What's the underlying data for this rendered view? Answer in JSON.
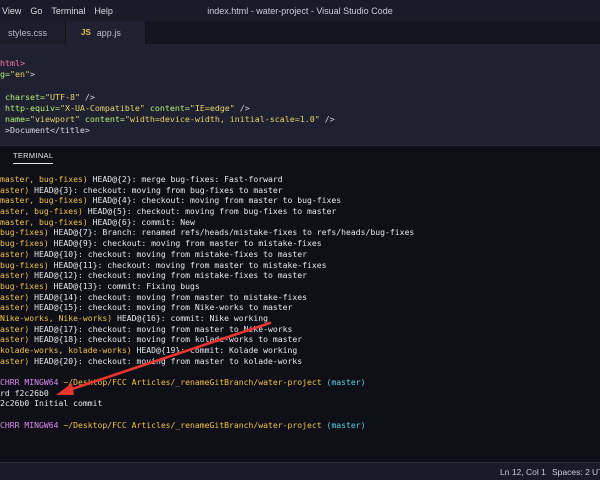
{
  "menu": [
    "View",
    "Go",
    "Terminal",
    "Help"
  ],
  "window_title": "index.html - water-project - Visual Studio Code",
  "tabs": [
    {
      "label": "styles.css",
      "icon": ""
    },
    {
      "label": "app.js",
      "icon": "JS"
    }
  ],
  "editor": {
    "lines": [
      [
        {
          "t": "html>",
          "c": "tag"
        }
      ],
      [
        {
          "t": "g=",
          "c": "attr"
        },
        {
          "t": "\"en\"",
          "c": "str"
        },
        {
          "t": ">",
          "c": "pl"
        }
      ],
      [],
      [
        {
          "t": " charset=",
          "c": "attr"
        },
        {
          "t": "\"UTF-8\"",
          "c": "str"
        },
        {
          "t": " />",
          "c": "pl"
        }
      ],
      [
        {
          "t": " http-equiv=",
          "c": "attr"
        },
        {
          "t": "\"X-UA-Compatible\"",
          "c": "str"
        },
        {
          "t": " content=",
          "c": "attr"
        },
        {
          "t": "\"IE=edge\"",
          "c": "str"
        },
        {
          "t": " />",
          "c": "pl"
        }
      ],
      [
        {
          "t": " name=",
          "c": "attr"
        },
        {
          "t": "\"viewport\"",
          "c": "str"
        },
        {
          "t": " content=",
          "c": "attr"
        },
        {
          "t": "\"width=device-width, initial-scale=1.0\"",
          "c": "str"
        },
        {
          "t": " />",
          "c": "pl"
        }
      ],
      [
        {
          "t": " >Document</title>",
          "c": "pl"
        }
      ]
    ]
  },
  "panel": {
    "tab": "TERMINAL"
  },
  "terminal": {
    "lines": [
      [
        {
          "t": "master, bug-fixes)",
          "c": "yellow"
        },
        {
          "t": " HEAD@{2}: merge bug-fixes: Fast-forward",
          "c": "white"
        }
      ],
      [
        {
          "t": "aster)",
          "c": "yellow"
        },
        {
          "t": " HEAD@{3}: checkout: moving from bug-fixes to master",
          "c": "white"
        }
      ],
      [
        {
          "t": "master, bug-fixes)",
          "c": "yellow"
        },
        {
          "t": " HEAD@{4}: checkout: moving from master to bug-fixes",
          "c": "white"
        }
      ],
      [
        {
          "t": "aster, bug-fixes)",
          "c": "yellow"
        },
        {
          "t": " HEAD@{5}: checkout: moving from bug-fixes to master",
          "c": "white"
        }
      ],
      [
        {
          "t": "master, bug-fixes)",
          "c": "yellow"
        },
        {
          "t": " HEAD@{6}: commit: New",
          "c": "white"
        }
      ],
      [
        {
          "t": "bug-fixes)",
          "c": "yellow"
        },
        {
          "t": " HEAD@{7}: Branch: renamed refs/heads/mistake-fixes to refs/heads/bug-fixes",
          "c": "white"
        }
      ],
      [
        {
          "t": "bug-fixes)",
          "c": "yellow"
        },
        {
          "t": " HEAD@{9}: checkout: moving from master to mistake-fixes",
          "c": "white"
        }
      ],
      [
        {
          "t": "aster)",
          "c": "yellow"
        },
        {
          "t": " HEAD@{10}: checkout: moving from mistake-fixes to master",
          "c": "white"
        }
      ],
      [
        {
          "t": "bug-fixes)",
          "c": "yellow"
        },
        {
          "t": " HEAD@{11}: checkout: moving from master to mistake-fixes",
          "c": "white"
        }
      ],
      [
        {
          "t": "aster)",
          "c": "yellow"
        },
        {
          "t": " HEAD@{12}: checkout: moving from mistake-fixes to master",
          "c": "white"
        }
      ],
      [
        {
          "t": "bug-fixes)",
          "c": "yellow"
        },
        {
          "t": " HEAD@{13}: commit: Fixing bugs",
          "c": "white"
        }
      ],
      [
        {
          "t": "aster)",
          "c": "yellow"
        },
        {
          "t": " HEAD@{14}: checkout: moving from master to mistake-fixes",
          "c": "white"
        }
      ],
      [
        {
          "t": "aster)",
          "c": "yellow"
        },
        {
          "t": " HEAD@{15}: checkout: moving from Nike-works to master",
          "c": "white"
        }
      ],
      [
        {
          "t": "Nike-works, Nike-works)",
          "c": "yellow"
        },
        {
          "t": " HEAD@{16}: commit: Nike working",
          "c": "white"
        }
      ],
      [
        {
          "t": "aster)",
          "c": "yellow"
        },
        {
          "t": " HEAD@{17}: checkout: moving from master to Nike-works",
          "c": "white"
        }
      ],
      [
        {
          "t": "aster)",
          "c": "yellow"
        },
        {
          "t": " HEAD@{18}: checkout: moving from kolade-works to master",
          "c": "white"
        }
      ],
      [
        {
          "t": "kolade-works, kolade-works)",
          "c": "yellow"
        },
        {
          "t": " HEAD@{19}: commit: Kolade working",
          "c": "white"
        }
      ],
      [
        {
          "t": "aster)",
          "c": "yellow"
        },
        {
          "t": " HEAD@{20}: checkout: moving from master to kolade-works",
          "c": "white"
        }
      ],
      [],
      [
        {
          "t": "CHRR MINGW64",
          "c": "magenta"
        },
        {
          "t": " ~/Desktop/FCC Articles/_renameGitBranch/water-project",
          "c": "yellow"
        },
        {
          "t": " (master)",
          "c": "cyan"
        }
      ],
      [
        {
          "t": "rd f2c26b0",
          "c": "white"
        }
      ],
      [
        {
          "t": "2c26b0 Initial commit",
          "c": "white"
        }
      ],
      [],
      [
        {
          "t": "CHRR MINGW64",
          "c": "magenta"
        },
        {
          "t": " ~/Desktop/FCC Articles/_renameGitBranch/water-project",
          "c": "yellow"
        },
        {
          "t": " (master)",
          "c": "cyan"
        }
      ]
    ]
  },
  "status": {
    "position": "Ln 12, Col 1",
    "spaces": "Spaces: 2",
    "encoding": "UTF"
  },
  "colors": {
    "arrow": "#e8352e"
  }
}
